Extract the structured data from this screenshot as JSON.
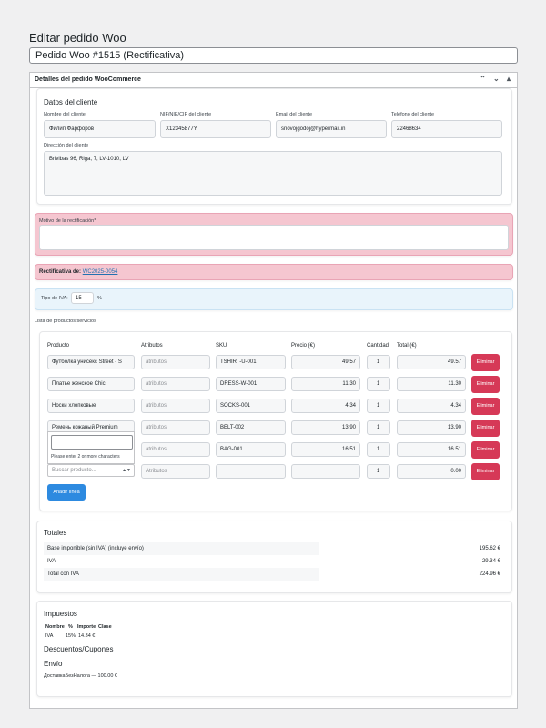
{
  "page": {
    "title": "Editar pedido Woo",
    "post_title": "Pedido Woo #1515 (Rectificativa)"
  },
  "metabox": {
    "title": "Detalles del pedido WooCommerce",
    "controls": "⌃ ⌄ ▴"
  },
  "cliente": {
    "section_title": "Datos del cliente",
    "name_label": "Nombre del cliente",
    "name_value": "Филип Фарфоров",
    "nif_label": "NIF/NIE/CIF del cliente",
    "nif_value": "X12345877Y",
    "email_label": "Email del cliente",
    "email_value": "snovojgodoj@hypermail.in",
    "phone_label": "Teléfono del cliente",
    "phone_value": "22468634",
    "address_label": "Dirección del cliente",
    "address_value": "Brivibas 96, Riga, 7, LV-1010, LV"
  },
  "rectificacion": {
    "motivo_label": "Motivo de la rectificación*",
    "motivo_value": "",
    "rectificativa_label": "Rectificativa de:",
    "rectificativa_link": "WC2025-0054"
  },
  "iva": {
    "label": "Tipo de IVA:",
    "value": "15",
    "suffix": "%"
  },
  "productos": {
    "section_label": "Lista de productos/servicios",
    "headers": [
      "Producto",
      "Atributos",
      "SKU",
      "Precio (€)",
      "Cantidad",
      "Total (€)"
    ],
    "attr_placeholder": "atributos",
    "attr_placeholder_empty": "Atributos",
    "delete_label": "Eliminar",
    "add_label": "Añadir línea",
    "rows": [
      {
        "product": "Футболка унисекс Street - S",
        "sku": "TSHIRT-U-001",
        "price": "49.57",
        "qty": "1",
        "total": "49.57"
      },
      {
        "product": "Платье женское Chic",
        "sku": "DRESS-W-001",
        "price": "11.30",
        "qty": "1",
        "total": "11.30"
      },
      {
        "product": "Носки хлопковые",
        "sku": "SOCKS-001",
        "price": "4.34",
        "qty": "1",
        "total": "4.34"
      },
      {
        "product": "Ремень кожаный Premium",
        "sku": "BELT-002",
        "price": "13.90",
        "qty": "1",
        "total": "13.90"
      },
      {
        "product": "",
        "sku": "BAG-001",
        "price": "16.51",
        "qty": "1",
        "total": "16.51"
      },
      {
        "product": "",
        "sku": "",
        "price": "",
        "qty": "1",
        "total": "0.00"
      }
    ],
    "dropdown_message": "Please enter 2 or more characters",
    "search_placeholder": "Buscar producto..."
  },
  "totales": {
    "title": "Totales",
    "rows": [
      {
        "label": "Base imponible (sin IVA) (incluye envío)",
        "value": "195.62 €"
      },
      {
        "label": "IVA",
        "value": "29.34 €"
      },
      {
        "label": "Total con IVA",
        "value": "224.96 €"
      }
    ]
  },
  "impuestos": {
    "title": "Impuestos",
    "headers": [
      "Nombre",
      "%",
      "Importe",
      "Clase"
    ],
    "row": {
      "name": "IVA",
      "pct": "15%",
      "amount": "14.34 €"
    },
    "descuentos_title": "Descuentos/Cupones",
    "envio_title": "Envío",
    "envio_line": "ДоставкаБезНалога — 100.00 €"
  },
  "colors": {
    "danger": "#d63957",
    "primary": "#2d8ae0",
    "pink_bg": "#f5c6d0",
    "info_bg": "#e9f4fb"
  }
}
